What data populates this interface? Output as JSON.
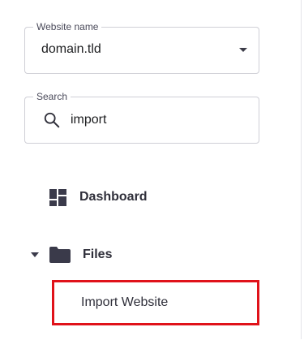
{
  "website_selector": {
    "label": "Website name",
    "value": "domain.tld",
    "icon": "chevron-down-icon"
  },
  "search": {
    "label": "Search",
    "value": "import",
    "icon": "search-icon"
  },
  "nav": {
    "dashboard": {
      "label": "Dashboard",
      "icon": "dashboard-icon"
    },
    "files": {
      "label": "Files",
      "icon": "folder-icon",
      "expanded": true,
      "children": [
        {
          "label": "Import Website",
          "highlighted": true,
          "highlight_color": "#e0121a"
        }
      ]
    }
  }
}
